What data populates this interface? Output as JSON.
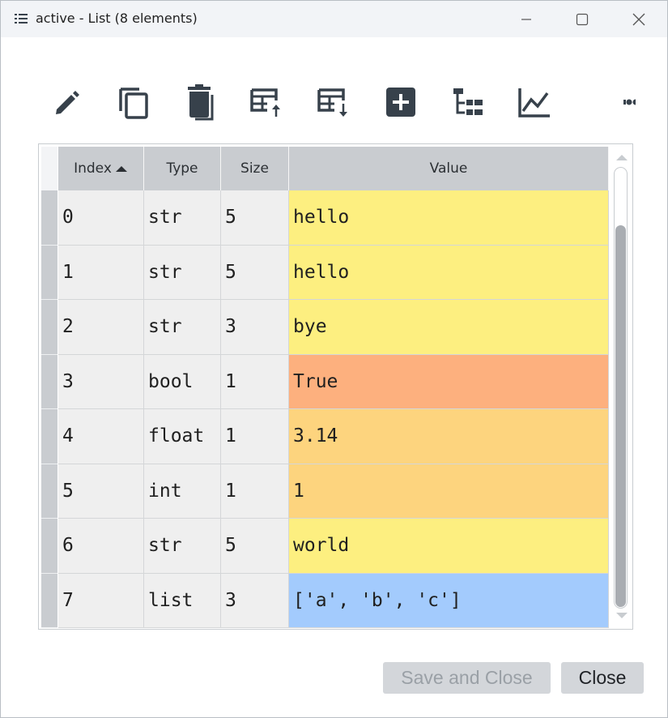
{
  "window": {
    "title": "active - List (8 elements)"
  },
  "icons": {
    "app": "list-icon",
    "minimize": "minimize-icon",
    "maximize": "maximize-icon",
    "close": "close-icon"
  },
  "toolbar": {
    "items": [
      {
        "name": "edit-icon"
      },
      {
        "name": "copy-icon"
      },
      {
        "name": "delete-icon"
      },
      {
        "name": "insert-above-icon"
      },
      {
        "name": "insert-below-icon"
      },
      {
        "name": "add-icon"
      },
      {
        "name": "tree-view-icon"
      },
      {
        "name": "plot-icon"
      },
      {
        "name": "more-icon"
      }
    ]
  },
  "table": {
    "headers": {
      "index": "Index",
      "type": "Type",
      "size": "Size",
      "value": "Value"
    },
    "sort_indicator": "ascending",
    "rows": [
      {
        "index": "0",
        "type": "str",
        "size": "5",
        "value": "hello",
        "color": "#fdef80"
      },
      {
        "index": "1",
        "type": "str",
        "size": "5",
        "value": "hello",
        "color": "#fdef80"
      },
      {
        "index": "2",
        "type": "str",
        "size": "3",
        "value": "bye",
        "color": "#fdef80"
      },
      {
        "index": "3",
        "type": "bool",
        "size": "1",
        "value": "True",
        "color": "#fdb07e"
      },
      {
        "index": "4",
        "type": "float",
        "size": "1",
        "value": "3.14",
        "color": "#fdd47e"
      },
      {
        "index": "5",
        "type": "int",
        "size": "1",
        "value": "1",
        "color": "#fdd47e"
      },
      {
        "index": "6",
        "type": "str",
        "size": "5",
        "value": "world",
        "color": "#fdef80"
      },
      {
        "index": "7",
        "type": "list",
        "size": "3",
        "value": "['a', 'b', 'c']",
        "color": "#a3cbfd"
      }
    ]
  },
  "buttons": {
    "save_close": "Save and Close",
    "close": "Close"
  },
  "colors": {
    "icon": "#37414b",
    "disabled_text": "#9aa0a6"
  }
}
